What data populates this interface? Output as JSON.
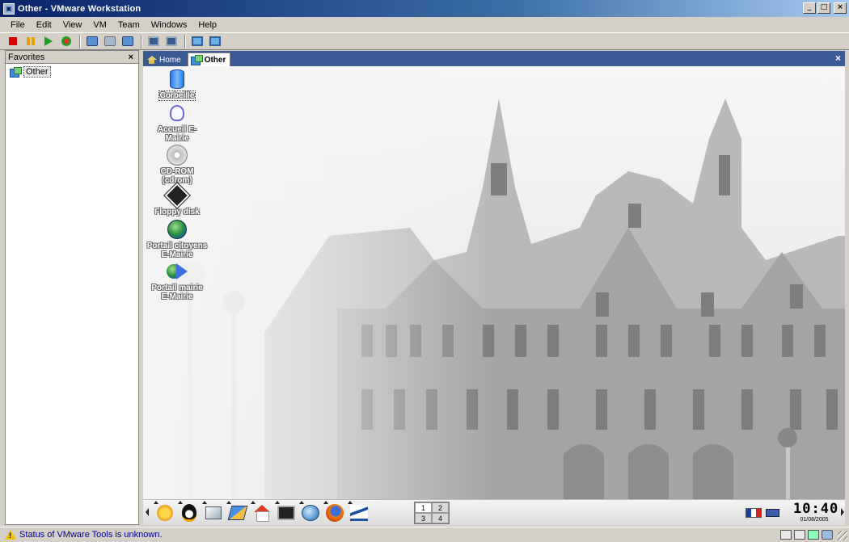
{
  "window": {
    "title": "Other - VMware Workstation",
    "controls": {
      "minimize": "_",
      "maximize": "□",
      "close": "×"
    }
  },
  "menu": [
    "File",
    "Edit",
    "View",
    "VM",
    "Team",
    "Windows",
    "Help"
  ],
  "toolbar": {
    "buttons": [
      {
        "name": "power-off",
        "icon": "red-square-icon"
      },
      {
        "name": "suspend",
        "icon": "pause-icon"
      },
      {
        "name": "power-on",
        "icon": "play-icon"
      },
      {
        "name": "reset",
        "icon": "reset-icon"
      },
      {
        "name": "snapshot",
        "icon": "camera-icon"
      },
      {
        "name": "revert-snapshot",
        "icon": "camera-revert-icon"
      },
      {
        "name": "snapshot-manager",
        "icon": "snapshot-manager-icon"
      },
      {
        "name": "full-screen",
        "icon": "monitor-icon"
      },
      {
        "name": "quick-switch",
        "icon": "monitor-switch-icon"
      },
      {
        "name": "unity",
        "icon": "monitor-small-icon"
      },
      {
        "name": "console-view",
        "icon": "monitor-console-icon"
      }
    ]
  },
  "favorites": {
    "header": "Favorites",
    "close": "×",
    "items": [
      "Other"
    ]
  },
  "tabs": [
    {
      "label": "Home",
      "active": false
    },
    {
      "label": "Other",
      "active": true
    }
  ],
  "tab_close": "×",
  "desktop": {
    "icons": [
      {
        "label": "Corbeille",
        "icon": "trash-icon"
      },
      {
        "label": "Accueil E-Mairie",
        "icon": "bulb-icon"
      },
      {
        "label": "CD-ROM (cdrom)",
        "icon": "cd-icon"
      },
      {
        "label": "Floppy disk",
        "icon": "floppy-icon"
      },
      {
        "label": "Portail citoyens E-Mairie",
        "icon": "globe-icon"
      },
      {
        "label": "Portail mairie E-Mairie",
        "icon": "globe-arrow-icon"
      }
    ]
  },
  "guest_taskbar": {
    "launchers": [
      "sun-icon",
      "tux-icon",
      "box-icon",
      "pen-icon",
      "home-icon",
      "terminal-icon",
      "globe-icon",
      "firefox-icon",
      "chart-icon"
    ],
    "pager": [
      "1",
      "2",
      "3",
      "4"
    ],
    "clock": {
      "time": "10:40",
      "date": "01/08/2005"
    }
  },
  "status": {
    "text": "Status of VMware Tools is unknown."
  }
}
